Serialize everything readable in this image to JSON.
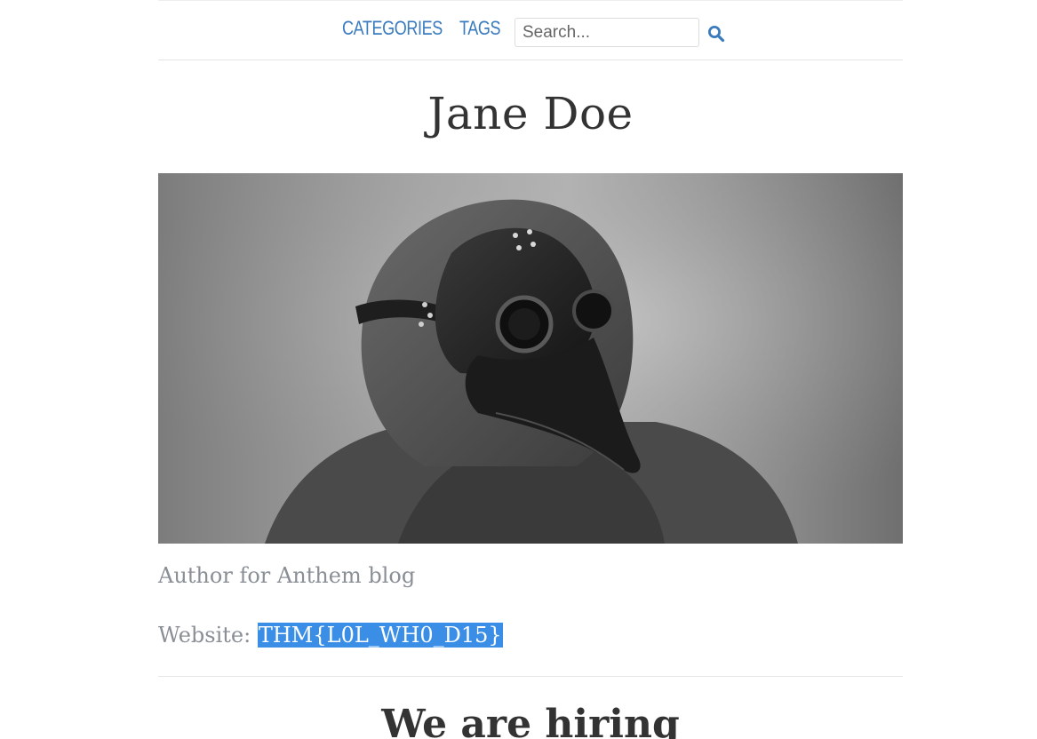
{
  "nav": {
    "categories_label": "CATEGORIES",
    "tags_label": "TAGS",
    "search_placeholder": "Search...",
    "search_icon": "search-icon"
  },
  "author": {
    "name": "Jane Doe",
    "photo": "plague-doctor-mask-portrait",
    "bio": "Author for Anthem blog",
    "website_label": "Website:",
    "website_value": "THM{L0L_WH0_D15}"
  },
  "section": {
    "heading": "We are hiring"
  },
  "colors": {
    "link": "#3a7bbf",
    "text_muted": "#8a8f96",
    "selection": "#3a8ee6"
  }
}
